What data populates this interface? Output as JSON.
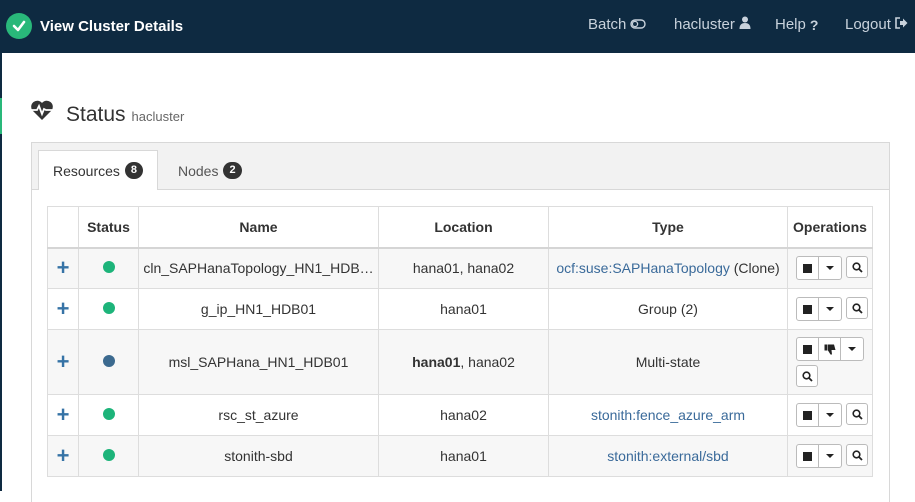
{
  "navbar": {
    "title": "View Cluster Details",
    "items": [
      {
        "label": "Batch",
        "icon": "toggle-icon"
      },
      {
        "label": "hacluster",
        "icon": "user-icon"
      },
      {
        "label": "Help",
        "icon": "question-icon"
      },
      {
        "label": "Logout",
        "icon": "logout-icon"
      }
    ]
  },
  "status": {
    "title": "Status",
    "subtitle": "hacluster"
  },
  "tabs": [
    {
      "label": "Resources",
      "count": "8"
    },
    {
      "label": "Nodes",
      "count": "2"
    }
  ],
  "table": {
    "headers": [
      "Status",
      "Name",
      "Location",
      "Type",
      "Operations"
    ],
    "rows": [
      {
        "status_color": "#1db47a",
        "name": "cln_SAPHanaTopology_HN1_HDB…",
        "location_bold": "",
        "location": "hana01, hana02",
        "type_link": "ocf:suse:SAPHanaTopology",
        "type_text": " (Clone)"
      },
      {
        "status_color": "#1db47a",
        "name": "g_ip_HN1_HDB01",
        "location_bold": "",
        "location": "hana01",
        "type_link": "",
        "type_text": "Group (2)"
      },
      {
        "status_color": "#3c6a8f",
        "name": "msl_SAPHana_HN1_HDB01",
        "location_bold": "hana01",
        "location": ", hana02",
        "type_link": "",
        "type_text": "Multi-state"
      },
      {
        "status_color": "#1db47a",
        "name": "rsc_st_azure",
        "location_bold": "",
        "location": "hana02",
        "type_link": "stonith:fence_azure_arm",
        "type_text": ""
      },
      {
        "status_color": "#1db47a",
        "name": "stonith-sbd",
        "location_bold": "",
        "location": "hana01",
        "type_link": "stonith:external/sbd",
        "type_text": ""
      }
    ]
  }
}
